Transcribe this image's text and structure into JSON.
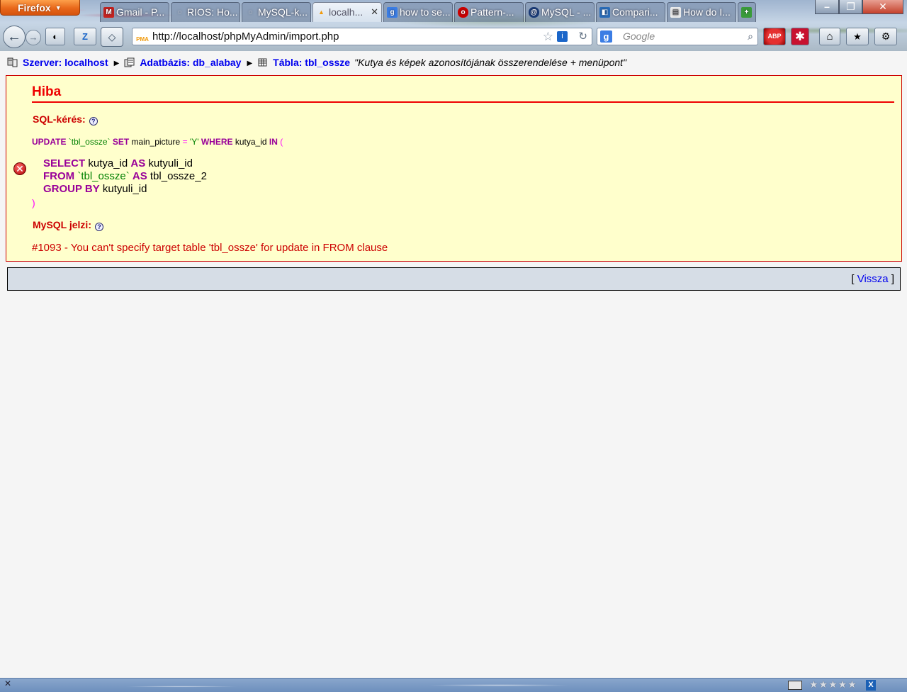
{
  "browser": {
    "menu_button": "Firefox",
    "tabs": [
      {
        "label": "Gmail - P...",
        "icon": "gmail-icon",
        "color": "#c5221f"
      },
      {
        "label": "RIOS: Ho...",
        "icon": "loading-icon",
        "color": "#888888"
      },
      {
        "label": "MySQL-k...",
        "icon": "loading-icon",
        "color": "#888888"
      },
      {
        "label": "localh...",
        "icon": "phpmyadmin-icon",
        "color": "#f19a0b",
        "active": true
      },
      {
        "label": "how to se...",
        "icon": "google-icon",
        "color": "#3b7de4"
      },
      {
        "label": "Pattern-...",
        "icon": "oracle-icon",
        "color": "#cc0000"
      },
      {
        "label": "MySQL - ...",
        "icon": "mysql-icon",
        "color": "#1b3d7a"
      },
      {
        "label": "Compari...",
        "icon": "compare-icon",
        "color": "#2a6ebb"
      },
      {
        "label": "How do I...",
        "icon": "document-icon",
        "color": "#5a6470"
      }
    ],
    "url": "http://localhost/phpMyAdmin/import.php",
    "search_placeholder": "Google"
  },
  "breadcrumb": {
    "server": "Szerver: localhost",
    "database": "Adatbázis: db_alabay",
    "table": "Tábla: tbl_ossze",
    "table_comment": "\"Kutya és képek azonosítójának összerendelése + menüpont\""
  },
  "error": {
    "title": "Hiba",
    "sql_label": "SQL-kérés:",
    "sql_line1": {
      "kw1": "UPDATE",
      "tbl": "`tbl_ossze`",
      "kw2": "SET",
      "col": "main_picture",
      "eq": "=",
      "val": "'Y'",
      "kw3": "WHERE",
      "col2": "kutya_id",
      "kw4": "IN",
      "paren": "("
    },
    "sql_sub": {
      "select_kw": "SELECT",
      "select_col": "kutya_id",
      "as_kw1": "AS",
      "alias1": "kutyuli_id",
      "from_kw": "FROM",
      "from_tbl": "`tbl_ossze`",
      "as_kw2": "AS",
      "alias2": "tbl_ossze_2",
      "group_kw": "GROUP BY",
      "group_col": "kutyuli_id",
      "close_paren": ")"
    },
    "mysql_label": "MySQL jelzi:",
    "message": "#1093 - You can't specify target table 'tbl_ossze' for update in FROM clause"
  },
  "back": {
    "open_bracket": "[",
    "link": "Vissza",
    "close_bracket": "]"
  }
}
